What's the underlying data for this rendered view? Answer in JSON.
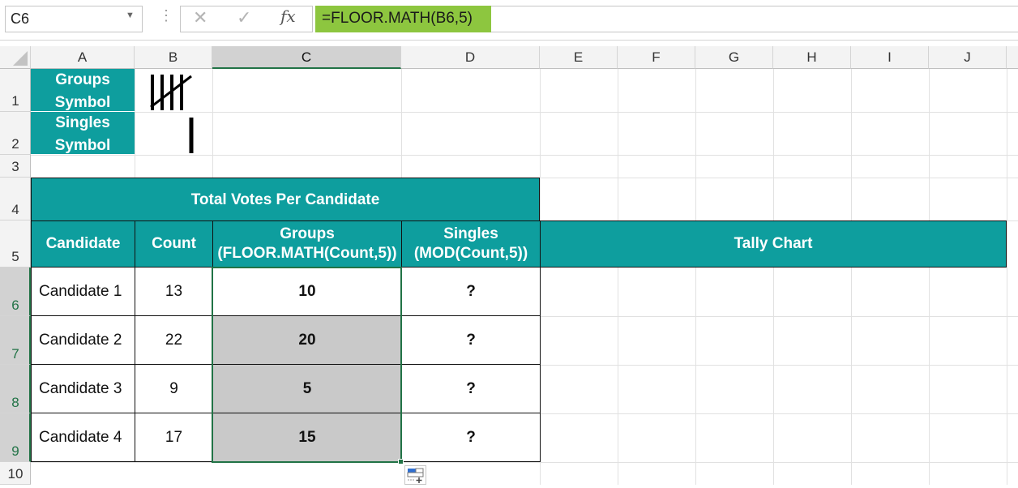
{
  "name_box": {
    "value": "C6"
  },
  "formula_bar": {
    "cancel_glyph": "✕",
    "enter_glyph": "✓",
    "fx_label": "fx",
    "formula": "=FLOOR.MATH(B6,5)"
  },
  "columns": [
    "A",
    "B",
    "C",
    "D",
    "E",
    "F",
    "G",
    "H",
    "I",
    "J"
  ],
  "rows": [
    "1",
    "2",
    "3",
    "4",
    "5",
    "6",
    "7",
    "8",
    "9",
    "10"
  ],
  "legend": {
    "groups_label": [
      "Groups",
      "Symbol"
    ],
    "singles_label": [
      "Singles",
      "Symbol"
    ]
  },
  "table": {
    "title": "Total Votes Per Candidate",
    "headers": {
      "candidate": "Candidate",
      "count": "Count",
      "groups": [
        "Groups",
        "(FLOOR.MATH(Count,5))"
      ],
      "singles": [
        "Singles",
        "(MOD(Count,5))"
      ],
      "tally": "Tally Chart"
    },
    "rows": [
      {
        "candidate": "Candidate 1",
        "count": "13",
        "groups": "10",
        "singles": "?"
      },
      {
        "candidate": "Candidate 2",
        "count": "22",
        "groups": "20",
        "singles": "?"
      },
      {
        "candidate": "Candidate 3",
        "count": "9",
        "groups": "5",
        "singles": "?"
      },
      {
        "candidate": "Candidate 4",
        "count": "17",
        "groups": "15",
        "singles": "?"
      }
    ]
  },
  "colors": {
    "teal": "#0e9e9e",
    "selection": "#217346",
    "formula_highlight": "#8dc63f",
    "selected_fill": "#c9c9c9"
  },
  "selected_cell": "C6",
  "selected_range": "C6:C9"
}
